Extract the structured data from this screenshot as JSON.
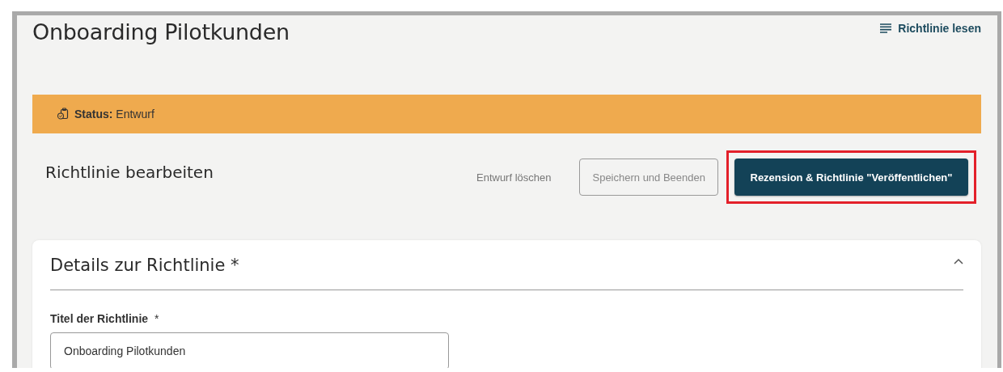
{
  "page": {
    "title": "Onboarding Pilotkunden",
    "read_link": "Richtlinie lesen"
  },
  "status_bar": {
    "label": "Status:",
    "value": "Entwurf"
  },
  "section": {
    "title": "Richtlinie bearbeiten"
  },
  "actions": [
    {
      "label": "Entwurf löschen",
      "kind": "text",
      "highlighted": false
    },
    {
      "label": "Speichern und Beenden",
      "kind": "outline",
      "highlighted": false
    },
    {
      "label": "Rezension & Richtlinie \"Veröffentlichen\"",
      "kind": "primary",
      "highlighted": true
    }
  ],
  "card": {
    "title": "Details zur Richtlinie *",
    "expanded": true,
    "fields": [
      {
        "label": "Titel der Richtlinie",
        "required_mark": "*",
        "value": "Onboarding Pilotkunden"
      }
    ]
  }
}
